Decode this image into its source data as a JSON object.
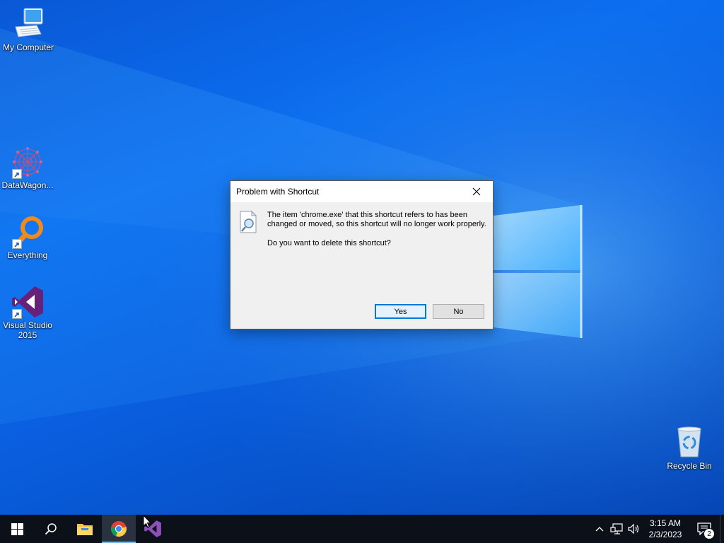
{
  "desktop": {
    "icons": [
      {
        "label": "My Computer",
        "icon": "computer-icon"
      },
      {
        "label": "DataWagon...",
        "icon": "datawagon-icon"
      },
      {
        "label": "Everything",
        "icon": "everything-search-icon"
      },
      {
        "label": "Visual Studio 2015",
        "icon": "visual-studio-icon"
      },
      {
        "label": "Recycle Bin",
        "icon": "recycle-bin-icon"
      }
    ]
  },
  "dialog": {
    "title": "Problem with Shortcut",
    "message": "The item 'chrome.exe' that this shortcut refers to has been changed or moved, so this shortcut will no longer work properly.",
    "question": "Do you want to delete this shortcut?",
    "yes_label": "Yes",
    "no_label": "No",
    "icon": "shortcut-search-icon"
  },
  "taskbar": {
    "buttons": [
      {
        "name": "start-button",
        "icon": "windows-logo-icon"
      },
      {
        "name": "search-button",
        "icon": "search-icon"
      },
      {
        "name": "file-explorer-button",
        "icon": "folder-icon"
      },
      {
        "name": "chrome-button",
        "icon": "chrome-icon",
        "active": true
      },
      {
        "name": "visual-studio-button",
        "icon": "visual-studio-icon"
      }
    ],
    "tray": {
      "time": "3:15 AM",
      "date": "2/3/2023",
      "notification_count": "2"
    }
  },
  "colors": {
    "accent": "#0078d7",
    "taskbar": "#0b1019",
    "desktop_blue": "#0b6ff0",
    "vs_purple": "#68217a"
  }
}
